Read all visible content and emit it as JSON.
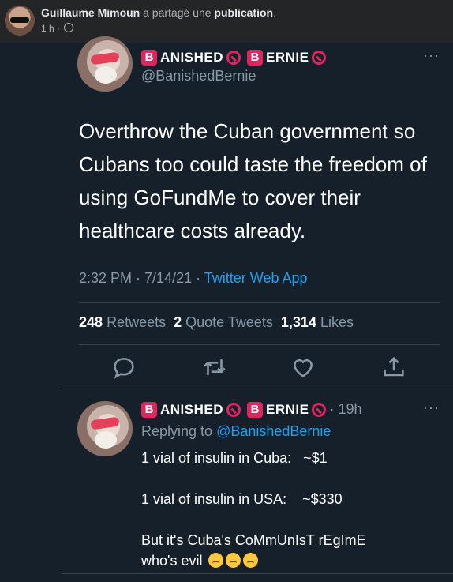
{
  "facebook": {
    "poster_name": "Guillaume Mimoun",
    "action_text": "a partagé une",
    "object_text": "publication",
    "time": "1 h",
    "separator": "·",
    "privacy_icon": "globe-icon"
  },
  "tweet": {
    "display_name_letter_1": "B",
    "display_name_word_1": "ANISHED",
    "display_name_letter_2": "B",
    "display_name_word_2": "ERNIE",
    "handle": "@BanishedBernie",
    "more": "···",
    "text": "Overthrow the Cuban government so Cubans too could taste the freedom of using GoFundMe to cover their healthcare costs already.",
    "time": "2:32 PM",
    "date": "7/14/21",
    "source": "Twitter Web App",
    "retweets_count": "248",
    "retweets_label": "Retweets",
    "quotes_count": "2",
    "quotes_label": "Quote Tweets",
    "likes_count": "1,314",
    "likes_label": "Likes",
    "actions": [
      "reply-icon",
      "retweet-icon",
      "like-icon",
      "share-icon"
    ]
  },
  "reply": {
    "display_name_letter_1": "B",
    "display_name_word_1": "ANISHED",
    "display_name_letter_2": "B",
    "display_name_word_2": "ERNIE",
    "age": "· 19h",
    "more": "···",
    "replying_prefix": "Replying to",
    "replying_handle": "@BanishedBernie",
    "line1": "1 vial of insulin in Cuba:   ~$1",
    "line2": "1 vial of insulin in USA:    ~$330",
    "line3": "But it's Cuba's CoMmUnIsT rEgImE",
    "line4": "who's evil",
    "emoji": "upside-down-face-icon"
  },
  "colors": {
    "background": "#15202b",
    "fb_header": "#242526",
    "accent_blue": "#1da1f2",
    "badge_red": "#e0245e",
    "muted": "#8899a6"
  }
}
